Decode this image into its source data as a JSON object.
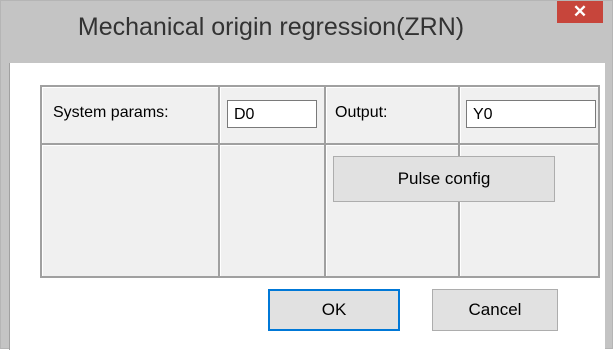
{
  "window": {
    "title": "Mechanical origin regression(ZRN)",
    "close_glyph": "✕"
  },
  "params": {
    "system_label": "System params:",
    "system_value": "D0",
    "output_label": "Output:",
    "output_value": "Y0"
  },
  "buttons": {
    "pulse_config": "Pulse config",
    "ok": "OK",
    "cancel": "Cancel"
  },
  "colors": {
    "close_button": "#c7453b",
    "frame": "#c4c4c4",
    "ok_border": "#0078d7"
  }
}
